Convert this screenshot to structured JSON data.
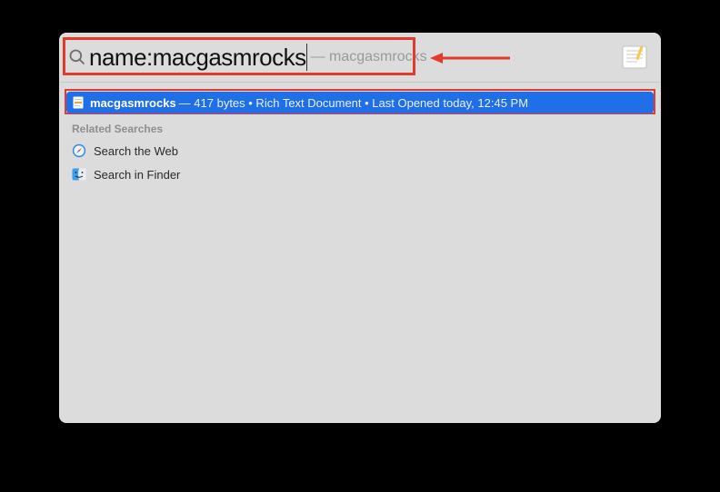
{
  "search": {
    "query": "name:macgasmrocks",
    "suggestion_prefix": "—",
    "suggestion_text": "macgasmrocks"
  },
  "top_hit": {
    "icon": "rtf-file-icon",
    "title": "macgasmrocks",
    "detail": "— 417 bytes • Rich Text Document • Last Opened today, 12:45 PM"
  },
  "related": {
    "header": "Related Searches",
    "items": [
      {
        "icon": "safari-icon",
        "label": "Search the Web"
      },
      {
        "icon": "finder-icon",
        "label": "Search in Finder"
      }
    ]
  },
  "app_preview_icon": "textedit-icon",
  "annotations": {
    "box1": "search-query-highlight",
    "box2": "top-hit-highlight",
    "arrow": "points-to-suggestion"
  }
}
